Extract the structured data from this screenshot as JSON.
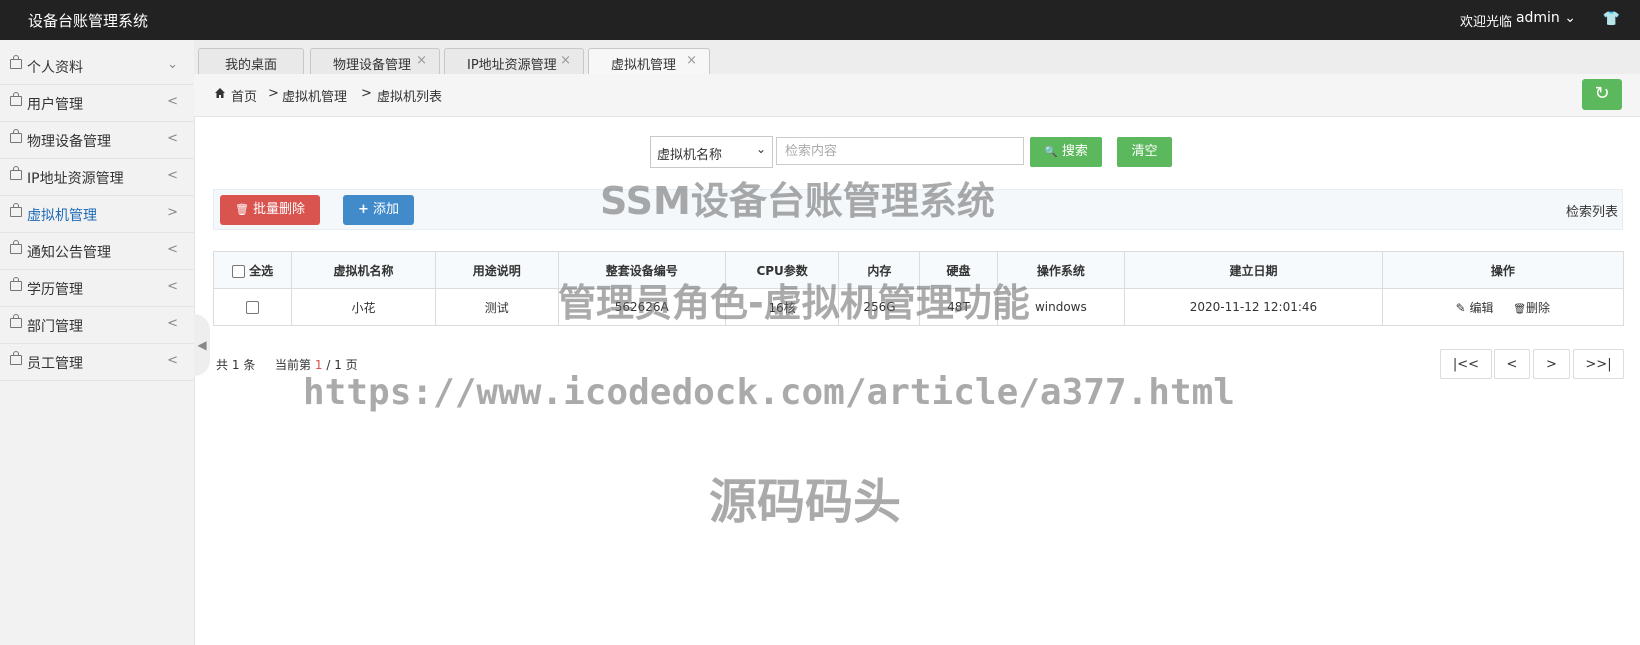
{
  "header": {
    "title": "设备台账管理系统",
    "welcome": "欢迎光临",
    "user": "admin",
    "user_caret": "⌄",
    "shirt_icon": "👕"
  },
  "sidebar": {
    "items": [
      {
        "label": "个人资料",
        "chevron": "⌄"
      },
      {
        "label": "用户管理",
        "chevron": "<"
      },
      {
        "label": "物理设备管理",
        "chevron": "<"
      },
      {
        "label": "IP地址资源管理",
        "chevron": "<"
      },
      {
        "label": "虚拟机管理",
        "chevron": ">"
      },
      {
        "label": "通知公告管理",
        "chevron": "<"
      },
      {
        "label": "学历管理",
        "chevron": "<"
      },
      {
        "label": "部门管理",
        "chevron": "<"
      },
      {
        "label": "员工管理",
        "chevron": "<"
      }
    ],
    "collapse_glyph": "◀"
  },
  "tabs": [
    {
      "label": "我的桌面",
      "close": ""
    },
    {
      "label": "物理设备管理",
      "close": "×"
    },
    {
      "label": "IP地址资源管理",
      "close": "×"
    },
    {
      "label": "虚拟机管理",
      "close": "×"
    }
  ],
  "breadcrumb": {
    "home": "首页",
    "sep": ">",
    "section": "虚拟机管理",
    "page": "虚拟机列表"
  },
  "search": {
    "select_value": "虚拟机名称",
    "select_arrow": "⌄",
    "placeholder": "检索内容",
    "search_label": "搜索",
    "clear_label": "清空",
    "search_icon": "🔍"
  },
  "actions": {
    "batch_delete": "批量删除",
    "add": "添加",
    "search_list": "检索列表",
    "trash_icon": "🗑",
    "plus_icon": "+"
  },
  "refresh_icon": "↻",
  "table": {
    "headers": [
      "全选",
      "虚拟机名称",
      "用途说明",
      "整套设备编号",
      "CPU参数",
      "内存",
      "硬盘",
      "操作系统",
      "建立日期",
      "操作"
    ],
    "rows": [
      {
        "name": "小花",
        "purpose": "测试",
        "device_no": "562626A",
        "cpu": "16核",
        "memory": "256G",
        "disk": "48T",
        "os": "windows",
        "date": "2020-11-12 12:01:46"
      }
    ],
    "edit_label": "编辑",
    "delete_label": "删除",
    "edit_icon": "✎",
    "delete_icon": "🗑"
  },
  "footer": {
    "total_prefix": "共",
    "total": "1",
    "total_suffix": "条",
    "current_prefix": "当前第",
    "current_page": "1",
    "page_sep": "/",
    "total_pages": "1",
    "page_suffix": "页"
  },
  "pager": {
    "first": "|<<",
    "prev": "<",
    "next": ">",
    "last": ">>|"
  },
  "watermarks": {
    "title": "SSM设备台账管理系统",
    "subtitle": "管理员角色-虚拟机管理功能",
    "url": "https://www.icodedock.com/article/a377.html",
    "brand": "源码码头"
  }
}
